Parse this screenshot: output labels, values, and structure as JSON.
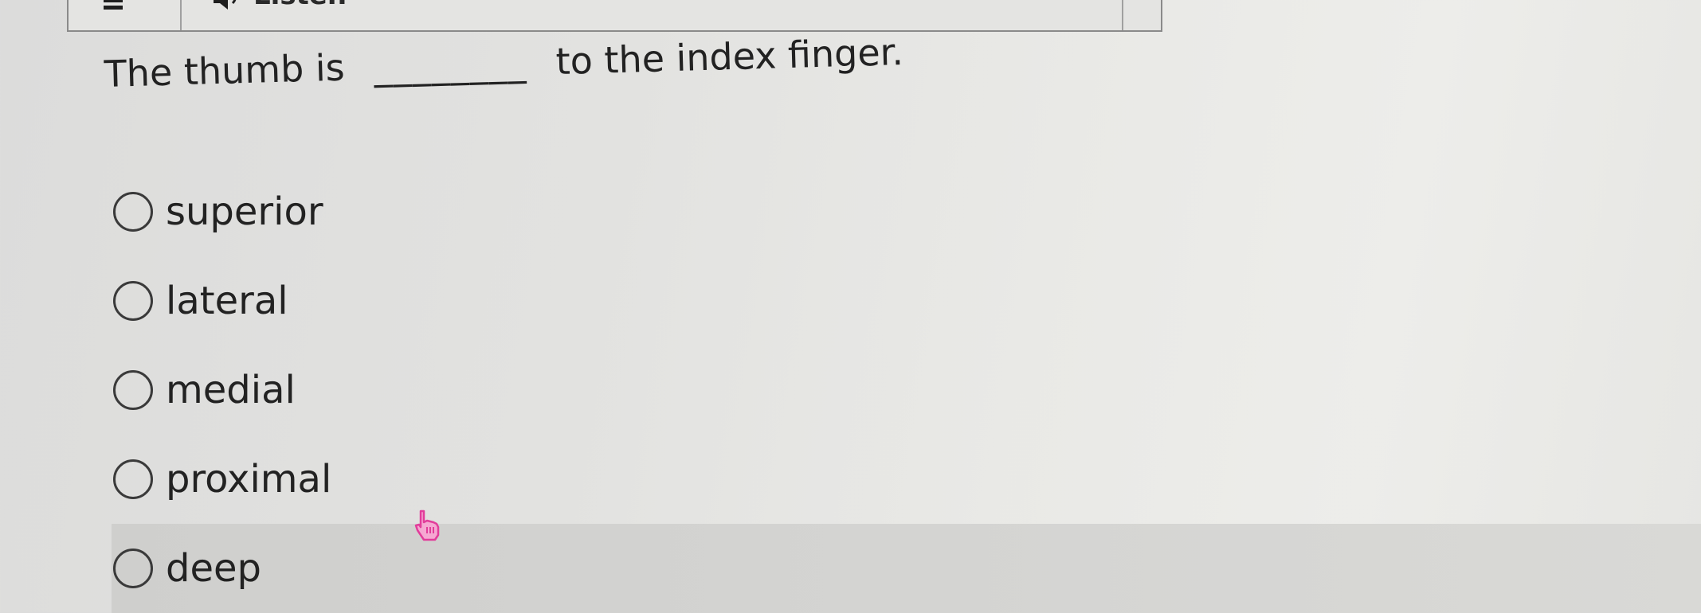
{
  "toolbar": {
    "menu_icon": "hamburger-menu-icon",
    "listen_icon": "speaker-icon",
    "listen_label": "Listen"
  },
  "question": {
    "before_blank": "The thumb is",
    "blank": "________",
    "after_blank": "to the index finger."
  },
  "options": [
    {
      "label": "superior",
      "selected": false
    },
    {
      "label": "lateral",
      "selected": false
    },
    {
      "label": "medial",
      "selected": false
    },
    {
      "label": "proximal",
      "selected": false
    },
    {
      "label": "deep",
      "selected": false,
      "hovered": true
    }
  ],
  "colors": {
    "hover_row": "#d2d2d0",
    "cursor": "#e23d9b"
  },
  "cursor_icon": "pointer-hand-icon"
}
